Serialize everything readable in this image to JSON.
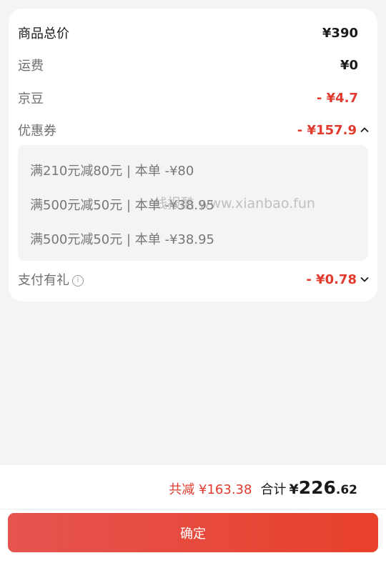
{
  "summary_card": {
    "goods_total": {
      "label": "商品总价",
      "value": "¥390"
    },
    "shipping": {
      "label": "运费",
      "value": "¥0"
    },
    "jingdou": {
      "label": "京豆",
      "value": "- ¥4.7"
    },
    "coupon": {
      "label": "优惠券",
      "value": "- ¥157.9"
    },
    "coupon_details": [
      "满210元减80元 | 本单 -¥80",
      "满500元减50元 | 本单 -¥38.95",
      "满500元减50元 | 本单 -¥38.95"
    ],
    "payment_gift": {
      "label": "支付有礼",
      "value": "- ¥0.78"
    }
  },
  "watermark": "线报酷 www.xianbao.fun",
  "footer": {
    "saved_text": "共减 ¥163.38",
    "total_label": "合计",
    "currency": "¥",
    "total_integer": "226",
    "total_decimal": ".62",
    "confirm_label": "确定"
  },
  "colors": {
    "accent_red": "#e23a2d",
    "button_start": "#e5544f",
    "button_end": "#e8412c"
  },
  "icons": {
    "coupon_toggle": "chevron-up-icon",
    "gift_toggle": "chevron-down-icon",
    "info": "info-icon"
  }
}
